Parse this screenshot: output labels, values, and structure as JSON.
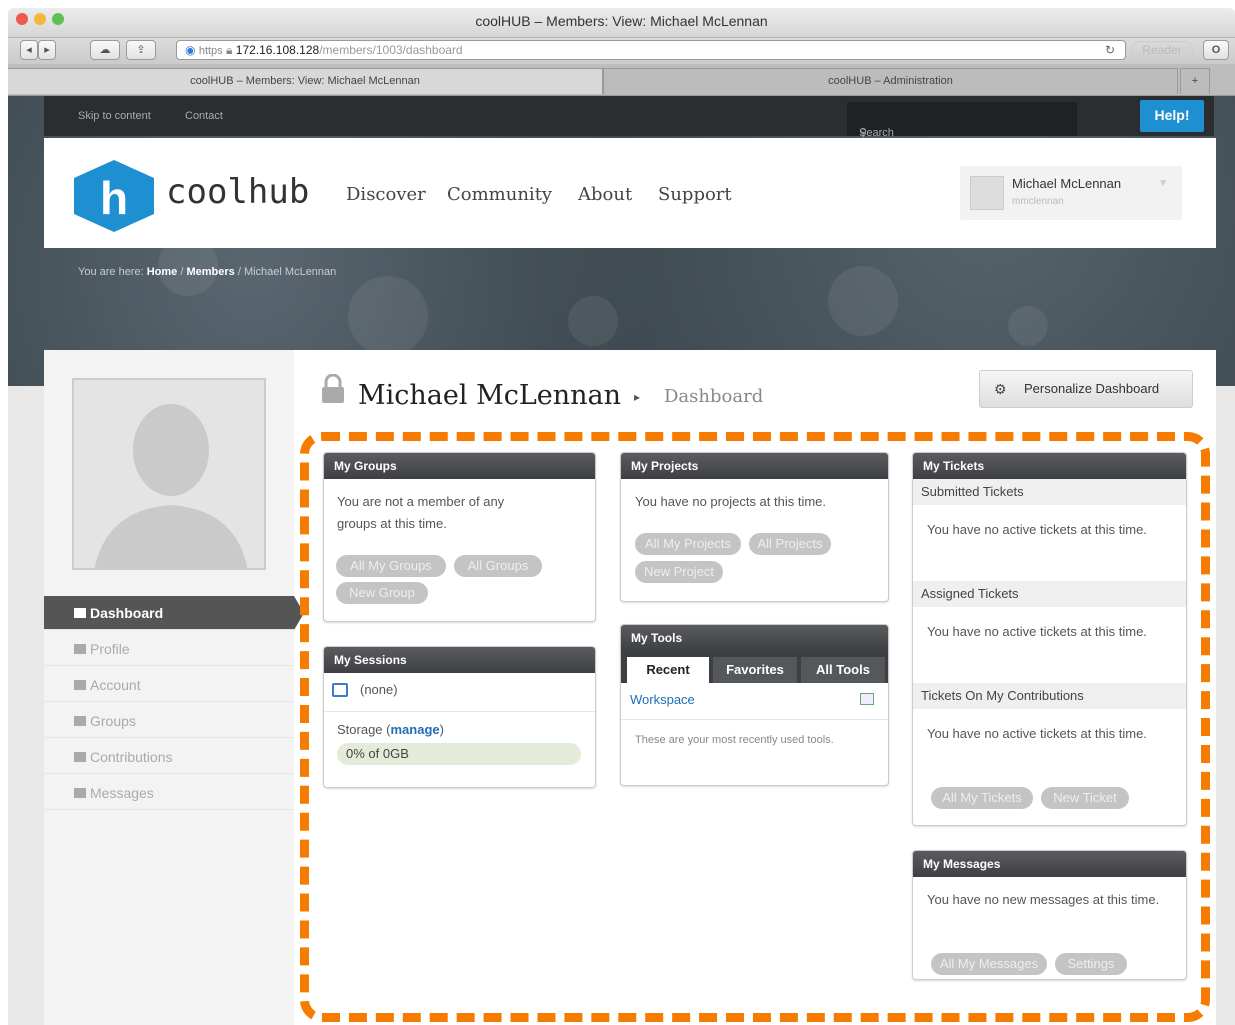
{
  "window": {
    "title": "coolHUB – Members: View: Michael McLennan"
  },
  "browser": {
    "url_scheme": "https",
    "url_host": "172.16.108.128",
    "url_path": "/members/1003/dashboard",
    "reader": "Reader",
    "tabs": [
      "coolHUB – Members: View: Michael McLennan",
      "coolHUB – Administration"
    ],
    "new_tab": "+"
  },
  "topbar": {
    "skip": "Skip to content",
    "contact": "Contact",
    "search_placeholder": "Search",
    "help": "Help!"
  },
  "header": {
    "logo_letter": "h",
    "brand": "coolhub",
    "nav": [
      "Discover",
      "Community",
      "About",
      "Support"
    ],
    "user_name": "Michael McLennan",
    "user_handle": "mmclennan"
  },
  "breadcrumb": {
    "prefix": "You are here:",
    "home": "Home",
    "sep": "/",
    "members": "Members",
    "current": "Michael McLennan"
  },
  "sidebar": {
    "items": [
      "Dashboard",
      "Profile",
      "Account",
      "Groups",
      "Contributions",
      "Messages"
    ]
  },
  "main": {
    "name": "Michael McLennan",
    "arrow": "▸",
    "section": "Dashboard",
    "personalize": "Personalize Dashboard"
  },
  "groups": {
    "title": "My Groups",
    "text": "You are not a member of any groups at this time.",
    "buttons": [
      "All My Groups",
      "All Groups",
      "New Group"
    ]
  },
  "sessions": {
    "title": "My Sessions",
    "none": "(none)",
    "storage": "Storage (",
    "manage": "manage",
    "storage_end": ")",
    "usage": "0% of 0GB"
  },
  "projects": {
    "title": "My Projects",
    "text": "You have no projects at this time.",
    "buttons": [
      "All My Projects",
      "All Projects",
      "New Project"
    ]
  },
  "tools": {
    "title": "My Tools",
    "tabs": [
      "Recent",
      "Favorites",
      "All Tools"
    ],
    "workspace": "Workspace",
    "text": "These are your most recently used tools."
  },
  "tickets": {
    "title": "My Tickets",
    "submitted": "Submitted Tickets",
    "assigned": "Assigned Tickets",
    "contrib": "Tickets On My Contributions",
    "none": "You have no active tickets at this time.",
    "buttons": [
      "All My Tickets",
      "New Ticket"
    ]
  },
  "messages": {
    "title": "My Messages",
    "text": "You have no new messages at this time.",
    "buttons": [
      "All My Messages",
      "Settings"
    ]
  },
  "colors": {
    "accent": "#1e8fd0",
    "highlight": "#f57c00",
    "logo": "#1e8fd0"
  }
}
